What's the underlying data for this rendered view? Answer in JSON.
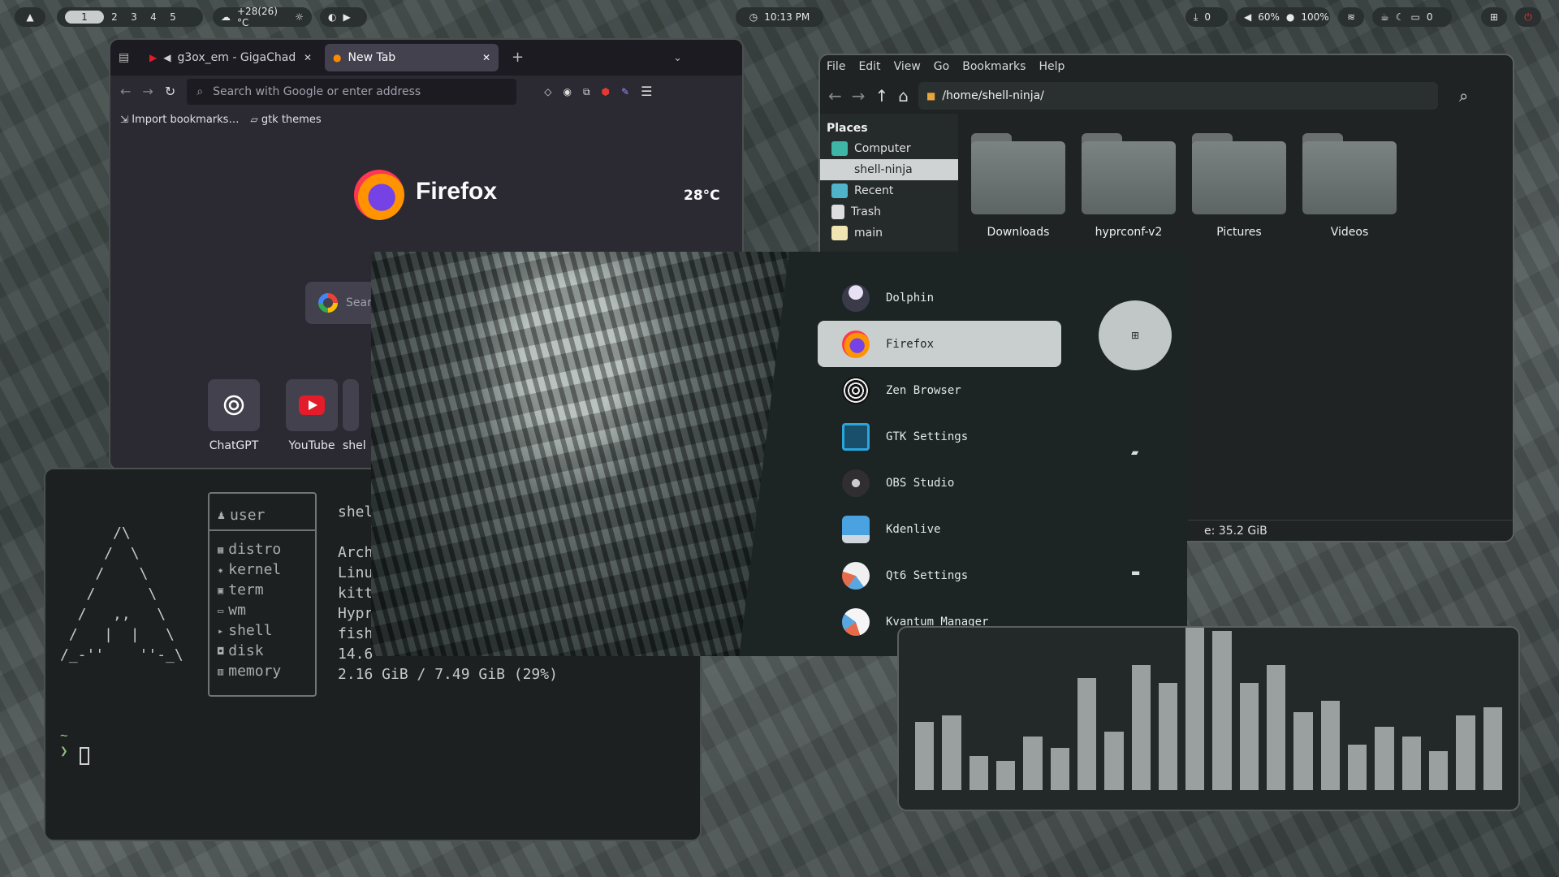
{
  "topbar": {
    "workspaces": [
      "1",
      "2",
      "3",
      "4",
      "5"
    ],
    "weather": "+28(26) °C",
    "clock": "10:13 PM",
    "downloads": "0",
    "volume": "60%",
    "mic": "100%",
    "clipboard": "0"
  },
  "firefox": {
    "tabs": [
      {
        "label": "g3ox_em - GigaChad"
      },
      {
        "label": "New Tab"
      }
    ],
    "url_placeholder": "Search with Google or enter address",
    "bookmarks": [
      "Import bookmarks…",
      "gtk themes"
    ],
    "wordmark": "Firefox",
    "weather": "28°C",
    "search_placeholder": "Sear",
    "shortcuts": [
      "ChatGPT",
      "YouTube",
      "shel"
    ]
  },
  "files": {
    "menu": [
      "File",
      "Edit",
      "View",
      "Go",
      "Bookmarks",
      "Help"
    ],
    "path": "/home/shell-ninja/",
    "places_heading": "Places",
    "places": [
      "Computer",
      "shell-ninja",
      "Recent",
      "Trash",
      "main"
    ],
    "folders": [
      "Downloads",
      "hyprconf-v2",
      "Pictures",
      "Videos"
    ],
    "status": "e: 35.2 GiB"
  },
  "terminal": {
    "ascii": "      /\\\n     /  \\\n    /    \\\n   /      \\\n  /   ,,   \\\n /   |  |   \\\n/_-''    ''-_\\",
    "user_label": "user",
    "labels": [
      "distro",
      "kernel",
      "term",
      "wm",
      "shell",
      "disk",
      "memory"
    ],
    "values": [
      "shel",
      "Arch",
      "Linu",
      "kitt",
      "Hypr",
      "fish",
      "14.6",
      "2.16 GiB / 7.49 GiB (29%)"
    ],
    "prompt_tilde": "~",
    "prompt_arrow": "❯"
  },
  "launcher": {
    "apps": [
      "Dolphin",
      "Firefox",
      "Zen Browser",
      "GTK Settings",
      "OBS Studio",
      "Kdenlive",
      "Qt6 Settings",
      "Kvantum Manager"
    ],
    "selected": "Firefox"
  },
  "visualizer": {
    "levels": [
      0.42,
      0.46,
      0.21,
      0.18,
      0.33,
      0.26,
      0.69,
      0.36,
      0.77,
      0.66,
      1.0,
      0.98,
      0.66,
      0.77,
      0.48,
      0.55,
      0.28,
      0.39,
      0.33,
      0.24,
      0.46,
      0.51
    ]
  },
  "colors": {
    "accent": "#c9cfcf",
    "power": "#e53935"
  }
}
